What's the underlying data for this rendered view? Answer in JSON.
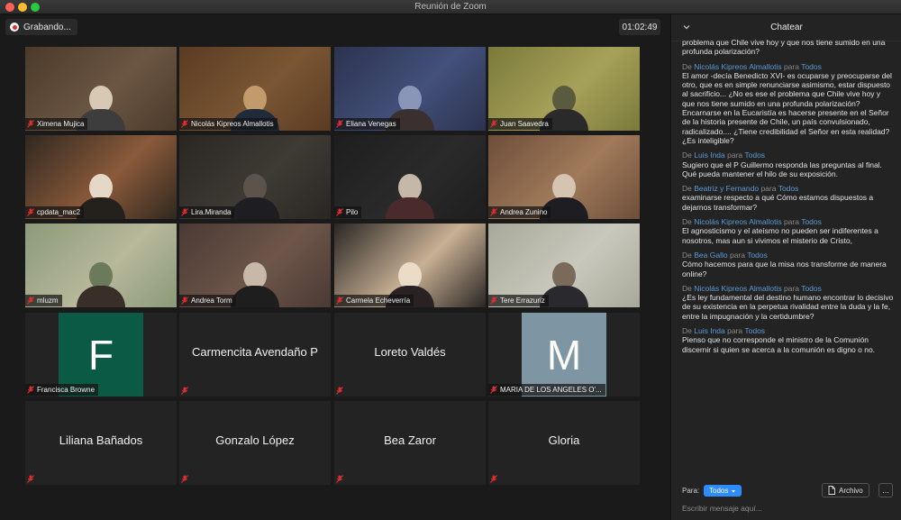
{
  "window": {
    "title": "Reunión de Zoom"
  },
  "recording": {
    "label": "Grabando..."
  },
  "timer": {
    "value": "01:02:49"
  },
  "participants": [
    {
      "name": "Ximena Mujica"
    },
    {
      "name": "Nicolás Kipreos Almallotis"
    },
    {
      "name": "Eliana Venegas"
    },
    {
      "name": "Juan Saavedra"
    },
    {
      "name": "cpdata_mac2"
    },
    {
      "name": "Lira.Miranda"
    },
    {
      "name": "Pilo"
    },
    {
      "name": "Andrea Zunino"
    },
    {
      "name": "mluzm"
    },
    {
      "name": "Andrea Torm"
    },
    {
      "name": "Carmela Echeverría"
    },
    {
      "name": "Tere Errazuriz"
    },
    {
      "name": "Francisca Browne",
      "initial": "F",
      "color": "#0b5a45"
    },
    {
      "name": "Carmencita Avendaño P"
    },
    {
      "name": "Loreto Valdés"
    },
    {
      "name": "MARIA DE LOS ANGELES O'...",
      "initial": "M",
      "color": "#7e95a3"
    },
    {
      "name": "Liliana Bañados"
    },
    {
      "name": "Gonzalo López"
    },
    {
      "name": "Bea Zaror"
    },
    {
      "name": "Gloria"
    }
  ],
  "chat": {
    "title": "Chatear",
    "de": "De",
    "para": "para",
    "messages": [
      {
        "sender": "",
        "to": "",
        "text": "problema que Chile vive hoy y que nos tiene sumido en una profunda polarización?"
      },
      {
        "sender": "Nicolás Kipreos Almallotis",
        "to": "Todos",
        "text": "El amor -decía Benedicto XVI- es ocuparse y preocuparse del otro, que es en simple renunciarse asimismo, estar dispuesto al sacrificio... ¿No es ese el problema que Chile vive hoy y que nos tiene sumido en una profunda polarización? Encarnarse en la Eucaristía es hacerse presente en el Señor de la historia presente de Chile, un país convulsionado, radicalizado.... ¿Tiene credibilidad el Señor en esta realidad? ¿Es inteligible?"
      },
      {
        "sender": "Luis Inda",
        "to": "Todos",
        "text": "Sugiero que el P Guillermo responda las preguntas al final. Qué pueda mantener el hilo de su exposición."
      },
      {
        "sender": "Beatriz y Fernando",
        "to": "Todos",
        "text": "examinarse respecto a qué Cómo estamos dispuestos a dejarnos transformar?"
      },
      {
        "sender": "Nicolás Kipreos Almallotis",
        "to": "Todos",
        "text": "El agnosticismo y el ateísmo no pueden ser indiferentes a nosotros, mas aun si vivimos el misterio de Cristo,"
      },
      {
        "sender": "Bea Gallo",
        "to": "Todos",
        "text": "Cómo hacemos para que la misa nos transforme de manera online?"
      },
      {
        "sender": "Nicolás Kipreos Almallotis",
        "to": "Todos",
        "text": "¿Es ley fundamental del destino humano encontrar lo decisivo de su existencia en la perpetua rivalidad entre la duda y la fe, entre la impugnación y la certidumbre?"
      },
      {
        "sender": "Luis Inda",
        "to": "Todos",
        "text": "Pienso que no corresponde el ministro de la Comunión discernir si quien se acerca a la comunión es digno o no."
      }
    ],
    "to_label": "Para:",
    "to_value": "Todos",
    "file_button": "Archivo",
    "more_button": "...",
    "placeholder": "Escribir mensaje aquí..."
  },
  "colors": {
    "accent": "#2d8cff",
    "link": "#5b9bd5",
    "mute": "#e02e2e"
  }
}
